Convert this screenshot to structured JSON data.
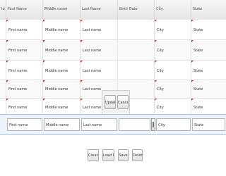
{
  "grid": {
    "columns": [
      {
        "label": "Id"
      },
      {
        "label": "First Name"
      },
      {
        "label": "Middle name"
      },
      {
        "label": "Last Name"
      },
      {
        "label": "Birth Date"
      },
      {
        "label": "City"
      },
      {
        "label": "State"
      }
    ],
    "rows": [
      {
        "first": "First name",
        "middle": "Middle name",
        "last": "Last name",
        "city": "City",
        "state": "State"
      },
      {
        "first": "First name",
        "middle": "Middle name",
        "last": "Last name",
        "city": "City",
        "state": "State"
      },
      {
        "first": "First name",
        "middle": "Middle name",
        "last": "Last name",
        "city": "City",
        "state": "State"
      },
      {
        "first": "First name",
        "middle": "Middle name",
        "last": "Last name",
        "city": "City",
        "state": "State"
      },
      {
        "first": "First name",
        "middle": "Middle name",
        "last": "Last name",
        "city": "City",
        "state": "State"
      }
    ],
    "row_editor": {
      "update_label": "Update",
      "cancel_label": "Cancel"
    },
    "new_row": {
      "first": "First name",
      "middle": "Middle name",
      "last": "Last name",
      "city": "City",
      "state": "State"
    }
  },
  "toolbar": {
    "buttons": [
      "Create",
      "Load Data",
      "Save",
      "Delete"
    ]
  },
  "colors": {
    "dirty_marker": "#d22222",
    "edit_row_bg": "#eef4fb"
  }
}
